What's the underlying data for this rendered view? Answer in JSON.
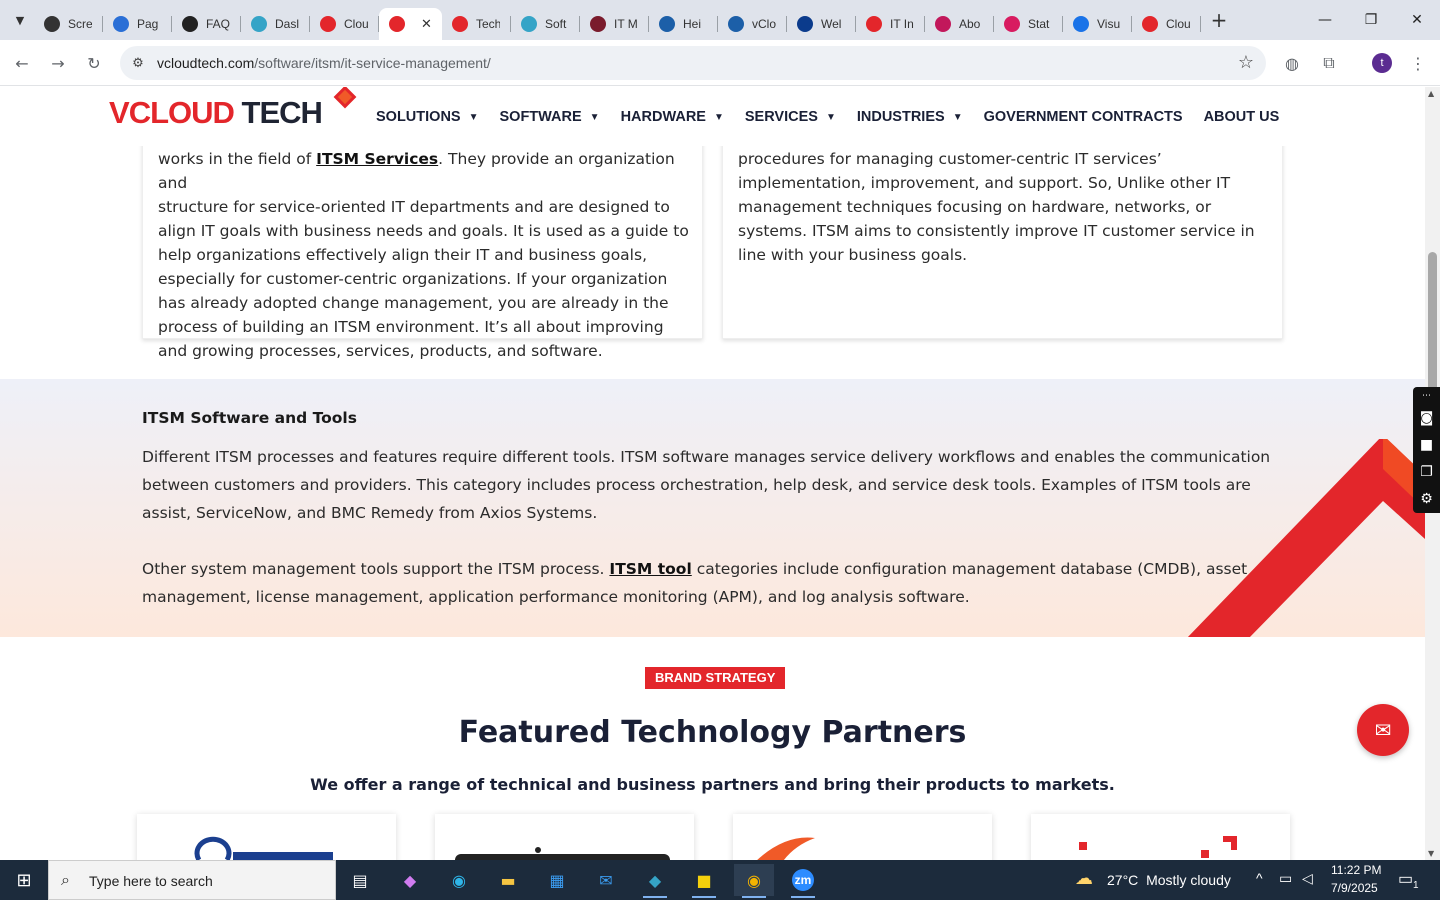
{
  "browser": {
    "tabs": [
      {
        "title": "Scre",
        "color": "#333333"
      },
      {
        "title": "Pag",
        "color": "#2a6fd6"
      },
      {
        "title": "FAQ",
        "color": "#222222"
      },
      {
        "title": "Dasl",
        "color": "#35a4c7"
      },
      {
        "title": "Clou",
        "color": "#e3262b"
      },
      {
        "title": "",
        "color": "#e3262b",
        "active": true
      },
      {
        "title": "Tech",
        "color": "#e3262b"
      },
      {
        "title": "Soft",
        "color": "#35a4c7"
      },
      {
        "title": "IT M",
        "color": "#7a1b2c"
      },
      {
        "title": "Hei",
        "color": "#1c5fa8"
      },
      {
        "title": "vClo",
        "color": "#1c5fa8"
      },
      {
        "title": "Wel",
        "color": "#0b3b8c"
      },
      {
        "title": "IT In",
        "color": "#e3262b"
      },
      {
        "title": "Abo",
        "color": "#c2185b"
      },
      {
        "title": "Stat",
        "color": "#d81b60"
      },
      {
        "title": "Visu",
        "color": "#1a73e8"
      },
      {
        "title": "Clou",
        "color": "#e3262b"
      }
    ],
    "url_host": "vcloudtech.com",
    "url_path": "/software/itsm/it-service-management/",
    "profile_initial": "t"
  },
  "site": {
    "logo_v": "V",
    "logo_cloud": "CLOUD",
    "logo_tech": " TECH",
    "menu": [
      {
        "label": "SOLUTIONS",
        "dropdown": true
      },
      {
        "label": "SOFTWARE",
        "dropdown": true
      },
      {
        "label": "HARDWARE",
        "dropdown": true
      },
      {
        "label": "SERVICES",
        "dropdown": true
      },
      {
        "label": "INDUSTRIES",
        "dropdown": true
      },
      {
        "label": "GOVERNMENT CONTRACTS",
        "dropdown": false
      },
      {
        "label": "ABOUT US",
        "dropdown": false
      }
    ]
  },
  "cards": {
    "left": {
      "line1_pre": "works in the field of ",
      "line1_link": "ITSM Services",
      "line1_post": ". They provide an organization and",
      "lines": [
        "structure for service-oriented IT departments and are designed to",
        "align IT goals with business needs and goals. It is used as a guide to",
        "help organizations effectively align their IT and business goals,",
        "especially for customer-centric organizations. If your organization",
        "has already adopted change management, you are already in the",
        "process of building an ITSM environment. It’s all about improving",
        "and growing processes, services, products, and software."
      ]
    },
    "right": {
      "lines": [
        "procedures for managing customer-centric IT services’",
        "implementation, improvement, and support. So, Unlike other IT",
        "management techniques focusing on hardware, networks, or",
        "systems. ITSM aims to consistently improve IT customer service in",
        "line with your business goals."
      ]
    }
  },
  "tools_section": {
    "heading": "ITSM Software and Tools",
    "para1_lines": [
      "Different ITSM processes and features require different tools. ITSM software manages service delivery workflows and enables the communication",
      "between customers and providers. This category includes process orchestration, help desk, and service desk tools. Examples of ITSM tools are",
      "assist, ServiceNow, and BMC Remedy from Axios Systems."
    ],
    "para2_pre": "Other system management tools support the ITSM process. ",
    "para2_link": "ITSM tool",
    "para2_post": " categories include configuration management database (CMDB), asset",
    "para2_line2": "management, license management, application performance monitoring (APM), and log analysis software."
  },
  "partners": {
    "badge": "BRAND STRATEGY",
    "title": "Featured Technology Partners",
    "subtitle": "We offer a range of technical and business partners and bring their products to markets."
  },
  "taskbar": {
    "search_placeholder": "Type here to search",
    "weather_temp": "27°C",
    "weather_desc": "Mostly cloudy",
    "time": "11:22 PM",
    "date": "7/9/2025",
    "notif_count": "1"
  },
  "colors": {
    "brand_red": "#e3262b",
    "nav_text": "#1a2036",
    "taskbar_bg": "#1c2b3c"
  }
}
